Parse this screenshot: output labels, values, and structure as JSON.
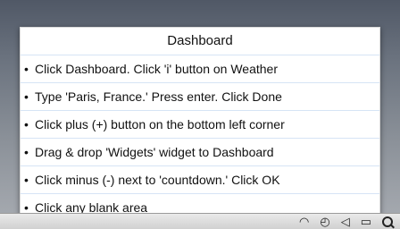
{
  "panel": {
    "title": "Dashboard",
    "items": [
      {
        "bullet": "•",
        "text": "Click Dashboard. Click 'i' button on Weather"
      },
      {
        "bullet": "•",
        "text": "Type 'Paris, France.' Press enter. Click Done"
      },
      {
        "bullet": "•",
        "text": "Click plus (+) button on the bottom left corner"
      },
      {
        "bullet": "•",
        "text": "Drag & drop 'Widgets' widget to Dashboard"
      },
      {
        "bullet": "•",
        "text": "Click minus (-) next to 'countdown.' Click OK"
      },
      {
        "bullet": "•",
        "text": "Click any blank area"
      }
    ]
  },
  "menubar": {
    "icons": [
      "airport-icon",
      "time-machine-icon",
      "volume-icon",
      "battery-icon",
      "spotlight-icon"
    ]
  }
}
